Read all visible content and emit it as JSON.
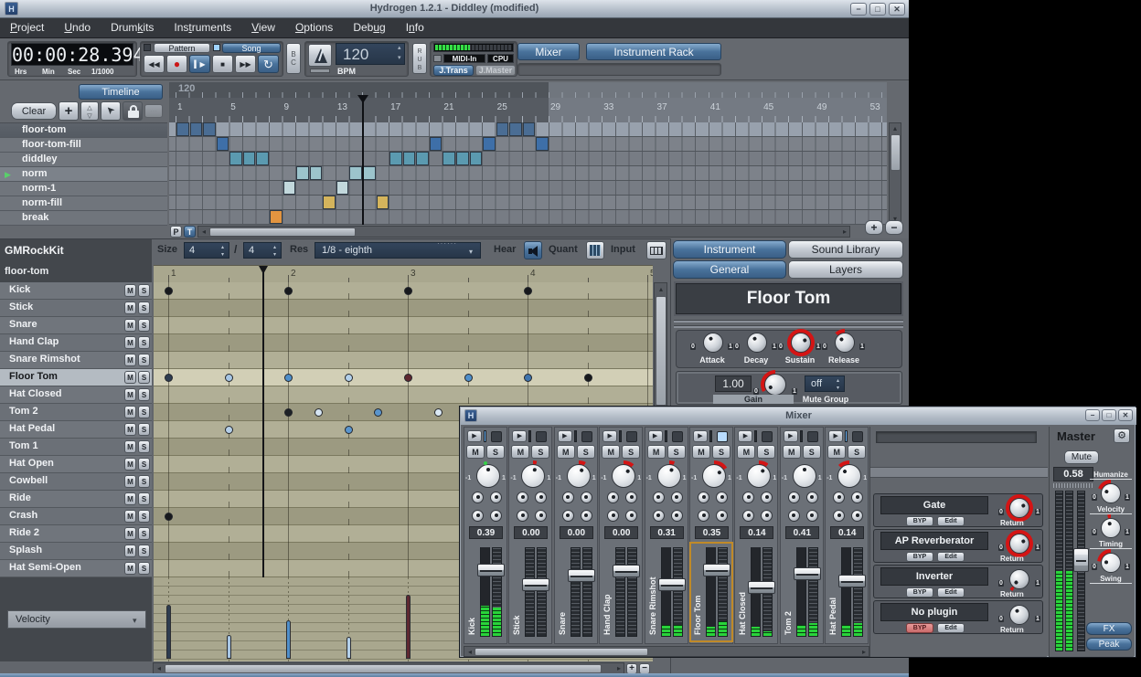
{
  "main_window": {
    "title": "Hydrogen 1.2.1 - Diddley (modified)",
    "menu": [
      {
        "label": "Project",
        "u": 0
      },
      {
        "label": "Undo",
        "u": 0
      },
      {
        "label": "Drumkits",
        "u": 4
      },
      {
        "label": "Instruments",
        "u": 3
      },
      {
        "label": "View",
        "u": 0
      },
      {
        "label": "Options",
        "u": 0
      },
      {
        "label": "Debug",
        "u": 3
      },
      {
        "label": "Info",
        "u": 1
      }
    ],
    "toolbar": {
      "time_value": "00:00:28.394",
      "time_units": [
        "Hrs",
        "Min",
        "Sec",
        "1/1000"
      ],
      "pattern_mode_label": "Pattern",
      "song_mode_label": "Song",
      "bc_label": "BC",
      "bpm_value": "120",
      "bpm_label": "BPM",
      "rub_label": "RUB",
      "midi_in_label": "MIDI-In",
      "cpu_label": "CPU",
      "cpu_meter_level": 0.45,
      "jack_transport_label": "J.Trans",
      "jack_master_label": "J.Master",
      "mixer_button": "Mixer",
      "instrument_rack_button": "Instrument Rack"
    },
    "song_editor": {
      "timeline_button": "Timeline",
      "clear_button": "Clear",
      "tempo_marker": "120",
      "ruler_numbers": [
        1,
        5,
        9,
        13,
        17,
        21,
        25,
        29,
        33,
        37,
        41,
        45,
        49,
        53
      ],
      "song_length_columns": 28,
      "playhead_column": 15,
      "patterns": [
        {
          "name": "floor-tom",
          "selected": true,
          "playing": false,
          "color": "#4a6d94",
          "cells": [
            1,
            2,
            3,
            25,
            26,
            27
          ]
        },
        {
          "name": "floor-tom-fill",
          "selected": false,
          "playing": false,
          "color": "#3e6fa8",
          "cells": [
            4,
            20,
            24,
            28
          ]
        },
        {
          "name": "diddley",
          "selected": false,
          "playing": false,
          "color": "#5b9ab0",
          "cells": [
            5,
            6,
            7,
            17,
            18,
            19,
            21,
            22,
            23
          ]
        },
        {
          "name": "norm",
          "selected": false,
          "playing": true,
          "color": "#9cc4cc",
          "cells": [
            10,
            11,
            14,
            15
          ]
        },
        {
          "name": "norm-1",
          "selected": false,
          "playing": false,
          "color": "#c2d8dc",
          "cells": [
            9,
            13
          ]
        },
        {
          "name": "norm-fill",
          "selected": false,
          "playing": false,
          "color": "#d4b45c",
          "cells": [
            12,
            16
          ]
        },
        {
          "name": "break",
          "selected": false,
          "playing": false,
          "color": "#e29440",
          "cells": [
            8
          ]
        }
      ],
      "pattern_toggle": "P",
      "timeline_toggle": "T"
    },
    "pattern_editor": {
      "drumkit_name": "GMRockKit",
      "pattern_name": "floor-tom",
      "size_label": "Size",
      "size_numerator": "4",
      "size_denominator": "4",
      "res_label": "Res",
      "res_value": "1/8 - eighth",
      "hear_label": "Hear",
      "quant_label": "Quant",
      "input_label": "Input",
      "ruler_numbers": [
        1,
        2,
        3,
        4,
        5
      ],
      "playhead_beat": 1.79,
      "mute_label": "M",
      "solo_label": "S",
      "instruments": [
        "Kick",
        "Stick",
        "Snare",
        "Hand Clap",
        "Snare Rimshot",
        "Floor Tom",
        "Hat Closed",
        "Tom 2",
        "Hat Pedal",
        "Tom 1",
        "Hat Open",
        "Cowbell",
        "Ride",
        "Crash",
        "Ride 2",
        "Splash",
        "Hat Semi-Open"
      ],
      "selected_instrument": "Floor Tom",
      "notes": [
        {
          "instrument": "Kick",
          "beat": 1,
          "color": "#17191d"
        },
        {
          "instrument": "Kick",
          "beat": 2,
          "color": "#17191d"
        },
        {
          "instrument": "Kick",
          "beat": 3,
          "color": "#17191d"
        },
        {
          "instrument": "Kick",
          "beat": 4,
          "color": "#17191d"
        },
        {
          "instrument": "Floor Tom",
          "beat": 1,
          "color": "#2e3c50"
        },
        {
          "instrument": "Floor Tom",
          "beat": 1.5,
          "color": "#a7c6e4"
        },
        {
          "instrument": "Floor Tom",
          "beat": 2,
          "color": "#4f8fca"
        },
        {
          "instrument": "Floor Tom",
          "beat": 2.5,
          "color": "#b3d0ea"
        },
        {
          "instrument": "Floor Tom",
          "beat": 3,
          "color": "#5e2730"
        },
        {
          "instrument": "Floor Tom",
          "beat": 3.5,
          "color": "#4f8fca"
        },
        {
          "instrument": "Floor Tom",
          "beat": 4,
          "color": "#3f74ad"
        },
        {
          "instrument": "Floor Tom",
          "beat": 4.5,
          "color": "#16181c"
        },
        {
          "instrument": "Tom 2",
          "beat": 2,
          "color": "#1d2126"
        },
        {
          "instrument": "Tom 2",
          "beat": 2.25,
          "color": "#d5e4f2"
        },
        {
          "instrument": "Tom 2",
          "beat": 2.75,
          "color": "#5a95cd"
        },
        {
          "instrument": "Tom 2",
          "beat": 3.25,
          "color": "#dbe9f5"
        },
        {
          "instrument": "Hat Pedal",
          "beat": 1.5,
          "color": "#b5cfe8"
        },
        {
          "instrument": "Hat Pedal",
          "beat": 2.5,
          "color": "#5a95cd"
        },
        {
          "instrument": "Crash",
          "beat": 1,
          "color": "#17191d"
        }
      ],
      "velocity_selector": "Velocity",
      "velocity_bars": [
        {
          "beat": 1,
          "value": 0.69,
          "color": "#2e3c50"
        },
        {
          "beat": 1.5,
          "value": 0.3,
          "color": "#a7c6e4"
        },
        {
          "beat": 2,
          "value": 0.49,
          "color": "#4f8fca"
        },
        {
          "beat": 2.5,
          "value": 0.28,
          "color": "#b3d0ea"
        },
        {
          "beat": 3,
          "value": 0.81,
          "color": "#5e2730"
        }
      ]
    },
    "instrument_rack": {
      "tab_instrument": "Instrument",
      "tab_sound_library": "Sound Library",
      "tab_general": "General",
      "tab_layers": "Layers",
      "instrument_name": "Floor Tom",
      "knob_min": "0",
      "knob_max": "1",
      "envelope_knobs": [
        {
          "label": "Attack",
          "arc": 0
        },
        {
          "label": "Decay",
          "arc": 0
        },
        {
          "label": "Sustain",
          "arc": 1
        },
        {
          "label": "Release",
          "arc": -0.15
        }
      ],
      "gain_value": "1.00",
      "gain_label": "Gain",
      "gain_knob_arc": -0.4,
      "mute_group_value": "off",
      "mute_group_label": "Mute Group"
    }
  },
  "mixer": {
    "title": "Mixer",
    "mute_label": "M",
    "solo_label": "S",
    "strips": [
      {
        "name": "Kick",
        "volume": "0.39",
        "fader": 0.22,
        "meter_l": 0.34,
        "meter_r": 0.32,
        "pan_arc": 0,
        "play_led": true,
        "selected_led": false,
        "selected": false
      },
      {
        "name": "Stick",
        "volume": "0.00",
        "fader": 0.42,
        "meter_l": 0,
        "meter_r": 0,
        "pan_arc": 0.1,
        "play_led": false,
        "selected_led": false,
        "selected": false
      },
      {
        "name": "Snare",
        "volume": "0.00",
        "fader": 0.3,
        "meter_l": 0,
        "meter_r": 0,
        "pan_arc": 0.18,
        "play_led": false,
        "selected_led": false,
        "selected": false
      },
      {
        "name": "Hand Clap",
        "volume": "0.00",
        "fader": 0.24,
        "meter_l": 0,
        "meter_r": 0,
        "pan_arc": 0.28,
        "play_led": false,
        "selected_led": false,
        "selected": false
      },
      {
        "name": "Snare Rimshot",
        "volume": "0.31",
        "fader": 0.42,
        "meter_l": 0.12,
        "meter_r": 0.12,
        "pan_arc": 0.14,
        "play_led": false,
        "selected_led": false,
        "selected": false
      },
      {
        "name": "Floor Tom",
        "volume": "0.35",
        "fader": 0.22,
        "meter_l": 0.1,
        "meter_r": 0.16,
        "pan_arc": 0.38,
        "play_led": false,
        "selected_led": true,
        "selected": true
      },
      {
        "name": "Hat Closed",
        "volume": "0.14",
        "fader": 0.46,
        "meter_l": 0.1,
        "meter_r": 0.05,
        "pan_arc": 0.25,
        "play_led": false,
        "selected_led": false,
        "selected": false
      },
      {
        "name": "Tom 2",
        "volume": "0.41",
        "fader": 0.27,
        "meter_l": 0.12,
        "meter_r": 0.14,
        "pan_arc": 0,
        "play_led": false,
        "selected_led": false,
        "selected": false
      },
      {
        "name": "Hat Pedal",
        "volume": "0.14",
        "fader": 0.37,
        "meter_l": 0.12,
        "meter_r": 0.14,
        "pan_arc": -0.3,
        "play_led": true,
        "selected_led": false,
        "selected": false
      }
    ],
    "fx_labels": {
      "byp": "BYP",
      "edit": "Edit",
      "return": "Return",
      "knob_min": "0",
      "knob_max": "1"
    },
    "fx_slots": [
      {
        "name": "Gate",
        "bypassed": false,
        "return_arc": 1
      },
      {
        "name": "AP Reverberator",
        "bypassed": false,
        "return_arc": 1
      },
      {
        "name": "Inverter",
        "bypassed": false,
        "return_arc": 0.05
      },
      {
        "name": "No plugin",
        "bypassed": true,
        "return_arc": 0
      }
    ],
    "master": {
      "title": "Master",
      "mute_button": "Mute",
      "volume": "0.58",
      "meter_l": 0.5,
      "meter_r": 0.5,
      "fader": 0.42,
      "knob_labels": [
        "Humanize",
        "Velocity",
        "Timing",
        "Swing"
      ],
      "knob_arcs": [
        -0.45,
        -0.1,
        -0.55
      ],
      "fx_button": "FX",
      "peak_button": "Peak"
    }
  }
}
